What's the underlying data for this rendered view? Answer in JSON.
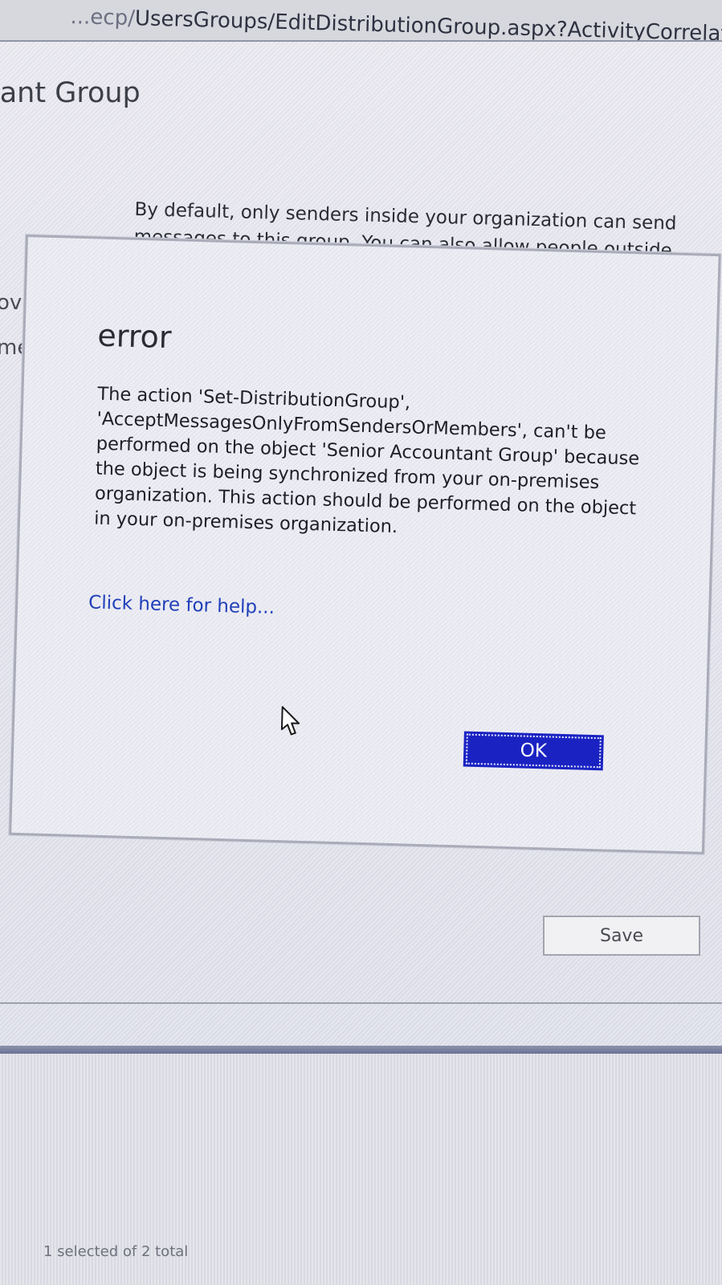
{
  "browser": {
    "url_partial_host": "...ecp/",
    "url_path": "UsersGroups/EditDistributionGroup.aspx?ActivityCorrelationID"
  },
  "page": {
    "title_partial": "tant Group",
    "description": "By default, only senders inside your organization can send messages to this group. You can also allow people outside",
    "side_label_1": "ova",
    "side_label_2": "me",
    "save_label": "Save",
    "status_text": "1 selected of 2 total"
  },
  "dialog": {
    "title": "error",
    "message": "The action 'Set-DistributionGroup', 'AcceptMessagesOnlyFromSendersOrMembers', can't be performed on the object 'Senior Accountant Group' because the object is being synchronized from your on-premises organization. This action should be performed on the object in your on-premises organization.",
    "help_link": "Click here for help...",
    "ok_label": "OK"
  },
  "icons": {
    "cursor": "mouse-pointer-icon"
  },
  "colors": {
    "ok_button": "#1a23c2",
    "link": "#1f3fb8"
  }
}
